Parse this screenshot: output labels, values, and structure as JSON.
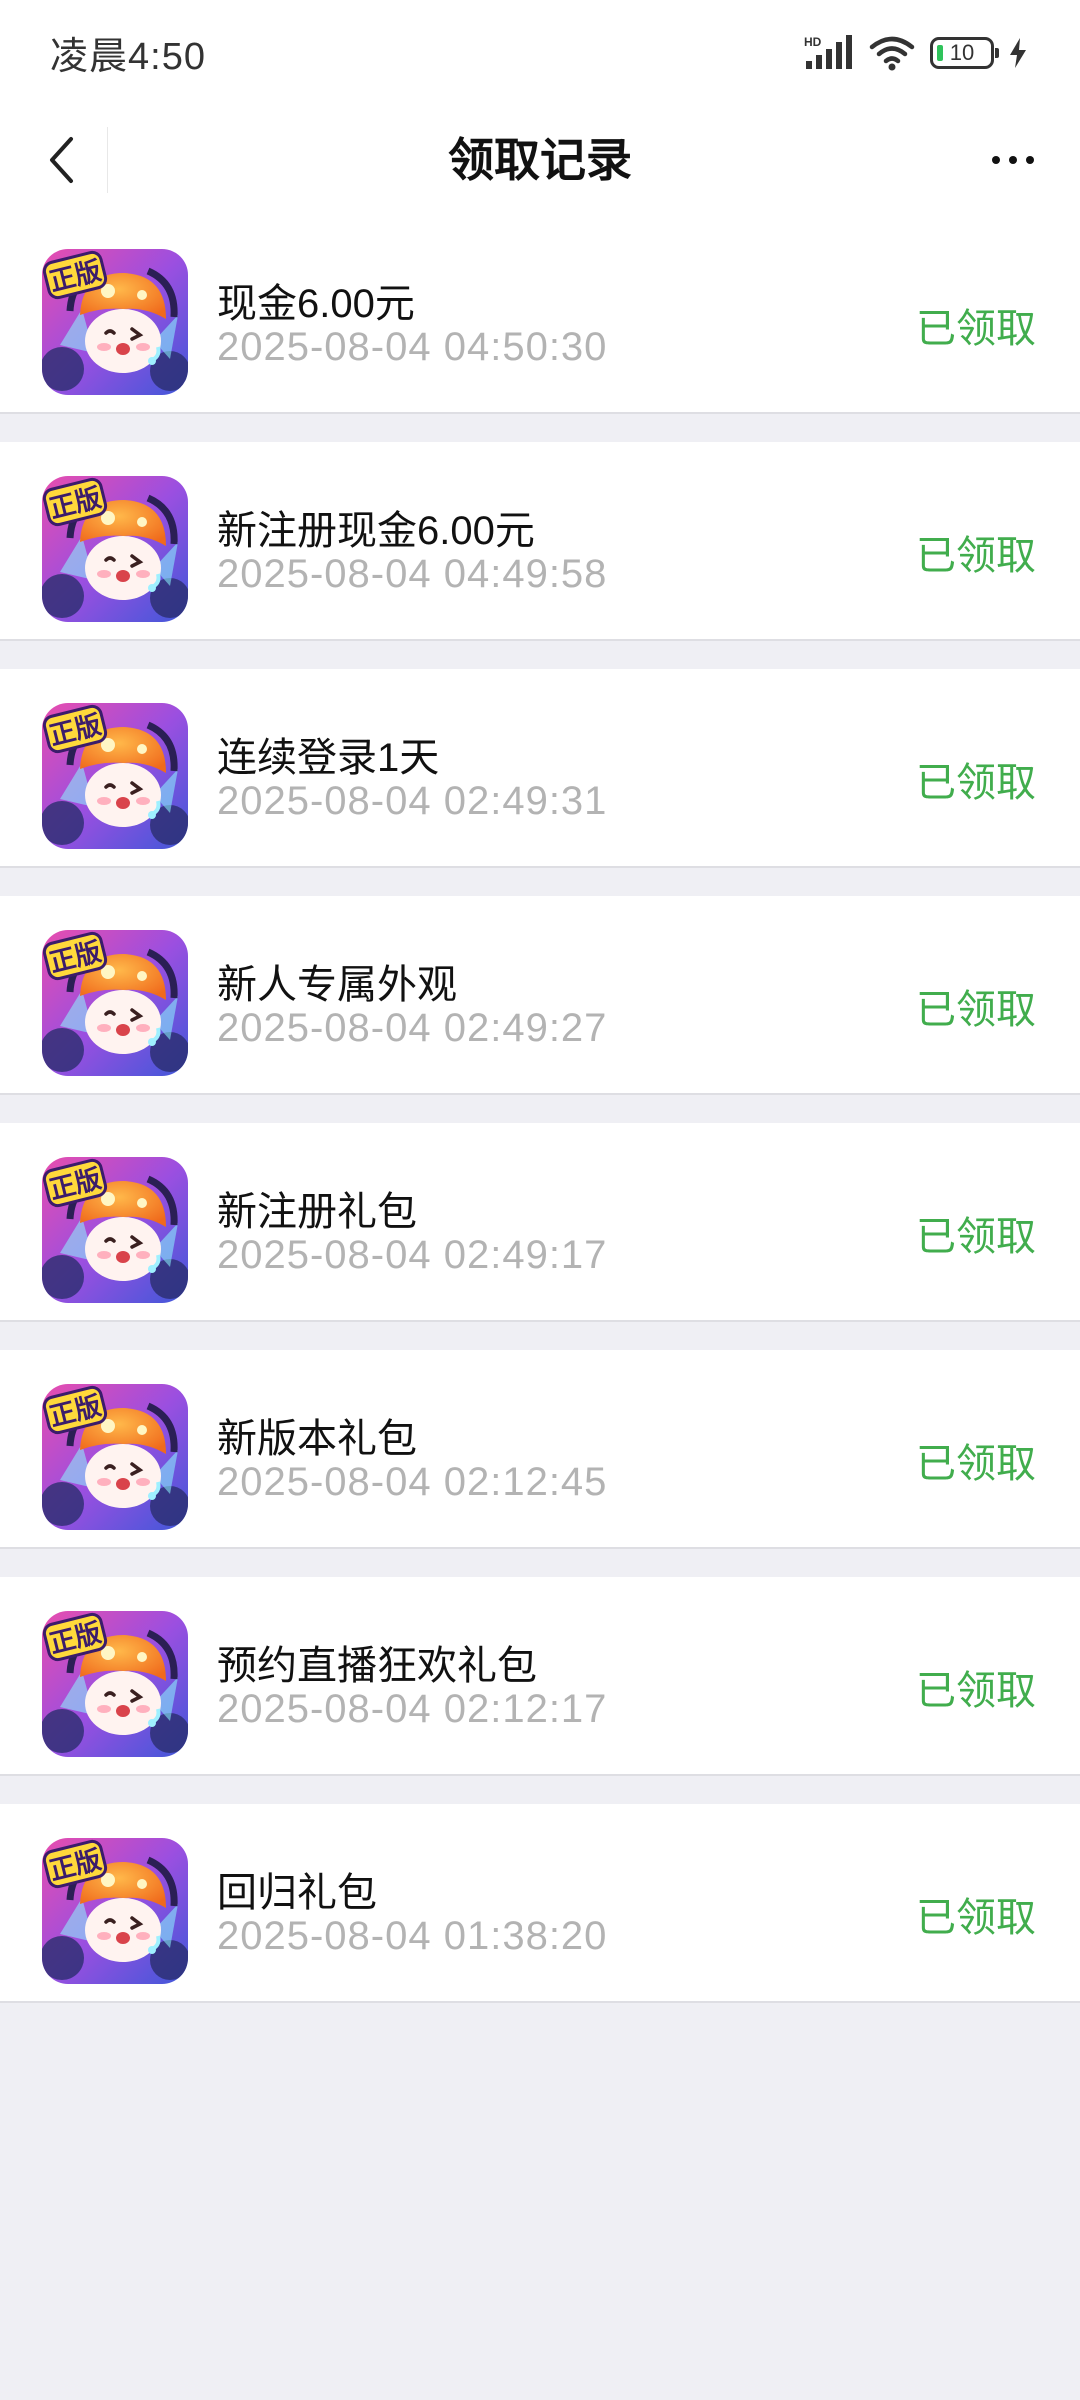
{
  "status_bar": {
    "time": "凌晨4:50",
    "network": "HD",
    "battery": "10"
  },
  "nav": {
    "title": "领取记录"
  },
  "records": [
    {
      "title": "现金6.00元",
      "time": "2025-08-04 04:50:30",
      "status": "已领取"
    },
    {
      "title": "新注册现金6.00元",
      "time": "2025-08-04 04:49:58",
      "status": "已领取"
    },
    {
      "title": "连续登录1天",
      "time": "2025-08-04 02:49:31",
      "status": "已领取"
    },
    {
      "title": "新人专属外观",
      "time": "2025-08-04 02:49:27",
      "status": "已领取"
    },
    {
      "title": "新注册礼包",
      "time": "2025-08-04 02:49:17",
      "status": "已领取"
    },
    {
      "title": "新版本礼包",
      "time": "2025-08-04 02:12:45",
      "status": "已领取"
    },
    {
      "title": "预约直播狂欢礼包",
      "time": "2025-08-04 02:12:17",
      "status": "已领取"
    },
    {
      "title": "回归礼包",
      "time": "2025-08-04 01:38:20",
      "status": "已领取"
    }
  ],
  "game_icon": {
    "badge_text": "正版"
  },
  "colors": {
    "status_green": "#41ad4d",
    "background": "#efeff4"
  }
}
